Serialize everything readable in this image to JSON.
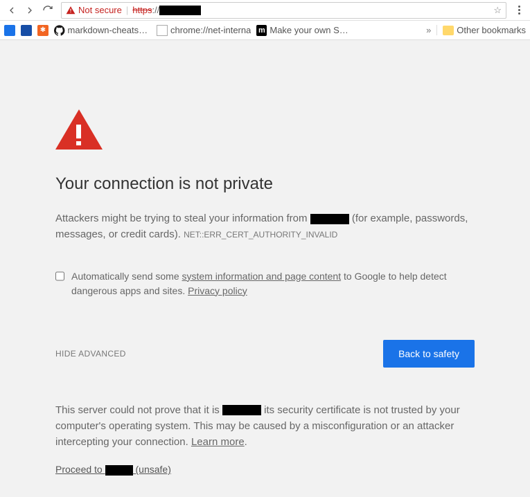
{
  "toolbar": {
    "not_secure": "Not secure",
    "url_https": "https",
    "url_sep": "://"
  },
  "bookmarks": {
    "b2": "markdown-cheatshee",
    "b3": "chrome://net-interna",
    "b4": "Make your own SSL C",
    "other": "Other bookmarks"
  },
  "page": {
    "title": "Your connection is not private",
    "para_a": "Attackers might be trying to steal your information from ",
    "para_b": " (for example, passwords, messages, or credit cards). ",
    "err": "NET::ERR_CERT_AUTHORITY_INVALID",
    "report_a": "Automatically send some ",
    "report_link": "system information and page content",
    "report_b": " to Google to help detect dangerous apps and sites. ",
    "privacy": "Privacy policy",
    "hide_adv": "HIDE ADVANCED",
    "back": "Back to safety",
    "adv_a": "This server could not prove that it is ",
    "adv_b": " its security certificate is not trusted by your computer's operating system. This may be caused by a misconfiguration or an attacker intercepting your connection. ",
    "learn": "Learn more",
    "proceed_a": "Proceed to ",
    "proceed_b": " (unsafe)"
  }
}
